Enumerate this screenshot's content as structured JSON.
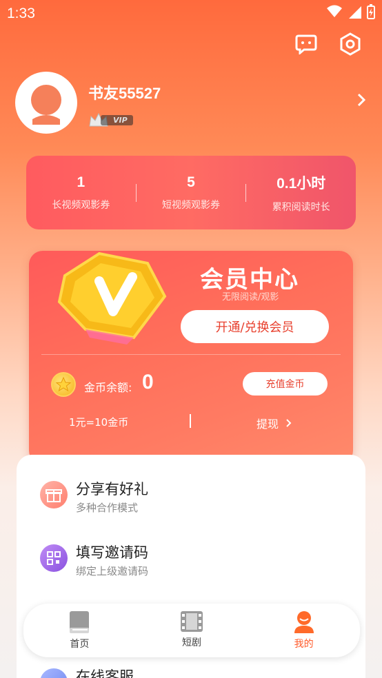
{
  "status_bar": {
    "time": "1:33"
  },
  "header_icons": [
    "chat-icon",
    "settings-hex-icon"
  ],
  "profile": {
    "username": "书友55527",
    "badge": "VIP"
  },
  "stats": [
    {
      "value": "1",
      "label": "长视频观影券"
    },
    {
      "value": "5",
      "label": "短视频观影券"
    },
    {
      "value": "0.1小时",
      "label": "累积阅读时长"
    }
  ],
  "vip_card": {
    "title": "会员中心",
    "subtitle": "无限阅读/观影",
    "open_button": "开通/兑换会员",
    "coin_label": "金币余额:",
    "coin_value": "0",
    "recharge_button": "充值金币",
    "rate": "1元=10金币",
    "withdraw": "提现"
  },
  "menu": [
    {
      "title": "分享有好礼",
      "subtitle": "多种合作模式",
      "icon": "gift-icon"
    },
    {
      "title": "填写邀请码",
      "subtitle": "绑定上级邀请码",
      "icon": "qr-code-icon"
    },
    {
      "title": "在线客服",
      "subtitle": "",
      "icon": "support-icon"
    }
  ],
  "tabs": [
    {
      "label": "首页",
      "icon": "book-icon",
      "active": false
    },
    {
      "label": "短剧",
      "icon": "film-icon",
      "active": false
    },
    {
      "label": "我的",
      "icon": "profile-icon",
      "active": true
    }
  ],
  "colors": {
    "accent": "#ff5a2a",
    "card_red": "#ff5b5f",
    "vip_gold": "#f6b41a"
  }
}
